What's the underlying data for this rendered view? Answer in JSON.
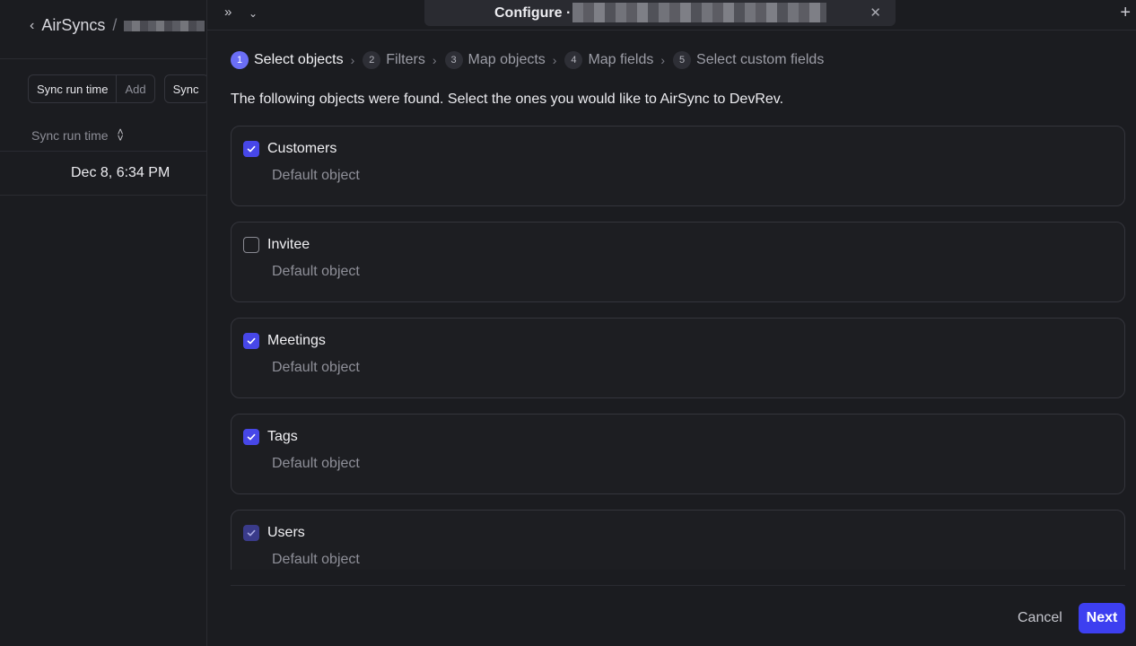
{
  "left": {
    "breadcrumb": {
      "back_icon": "chevron-left-icon",
      "root": "AirSyncs",
      "separator": "/"
    },
    "filters": [
      {
        "key": "Sync run time",
        "value": "Add"
      },
      {
        "key": "Sync",
        "value": ""
      }
    ],
    "table": {
      "column_header": "Sync run time",
      "sort_icon": "sort-updown-icon",
      "rows": [
        "Dec 8, 6:34 PM"
      ]
    }
  },
  "topbar": {
    "collapse_icon": "double-chevron-right-icon",
    "dropdown_icon": "chevron-down-icon",
    "title": "Configure ·",
    "close_icon": "close-icon",
    "new_tab_icon": "plus-icon"
  },
  "stepper": [
    {
      "num": "1",
      "label": "Select objects",
      "active": true
    },
    {
      "num": "2",
      "label": "Filters",
      "active": false
    },
    {
      "num": "3",
      "label": "Map objects",
      "active": false
    },
    {
      "num": "4",
      "label": "Map fields",
      "active": false
    },
    {
      "num": "5",
      "label": "Select custom fields",
      "active": false
    }
  ],
  "intro": "The following objects were found. Select the ones you would like to AirSync to DevRev.",
  "objects": [
    {
      "name": "Customers",
      "subtitle": "Default object",
      "checked": true
    },
    {
      "name": "Invitee",
      "subtitle": "Default object",
      "checked": false
    },
    {
      "name": "Meetings",
      "subtitle": "Default object",
      "checked": true
    },
    {
      "name": "Tags",
      "subtitle": "Default object",
      "checked": true
    },
    {
      "name": "Users",
      "subtitle": "Default object",
      "checked": true,
      "disabled": true
    }
  ],
  "footer": {
    "cancel": "Cancel",
    "next": "Next"
  },
  "colors": {
    "accent": "#3d3ff0",
    "checkbox": "#4747e8",
    "step_active": "#6b6ef5",
    "background": "#1b1c20"
  }
}
